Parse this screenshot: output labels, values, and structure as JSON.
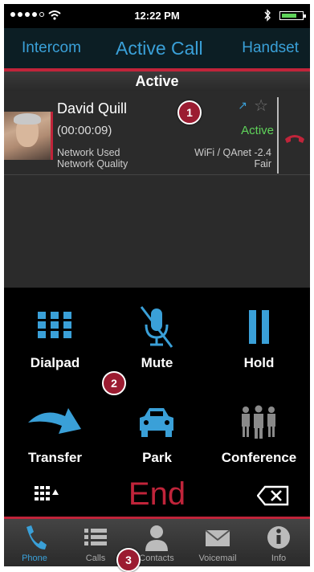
{
  "status_bar": {
    "time": "12:22 PM"
  },
  "nav": {
    "left": "Intercom",
    "center": "Active Call",
    "right": "Handset"
  },
  "section_title": "Active",
  "call": {
    "name": "David Quill",
    "duration": "(00:00:09)",
    "state": "Active",
    "network_used_label": "Network Used",
    "network_quality_label": "Network Quality",
    "network_value": "WiFi / QAnet -2.4",
    "quality_value": "Fair"
  },
  "controls": {
    "dialpad": "Dialpad",
    "mute": "Mute",
    "hold": "Hold",
    "transfer": "Transfer",
    "park": "Park",
    "conference": "Conference",
    "end": "End"
  },
  "tabs": [
    {
      "label": "Phone",
      "icon": "phone-icon"
    },
    {
      "label": "Calls",
      "icon": "list-icon"
    },
    {
      "label": "Contacts",
      "icon": "contact-icon"
    },
    {
      "label": "Voicemail",
      "icon": "envelope-icon"
    },
    {
      "label": "Info",
      "icon": "info-icon"
    }
  ],
  "badges": [
    "1",
    "2",
    "3"
  ],
  "colors": {
    "accent": "#3aa0d8",
    "end": "#c0243a",
    "active": "#5fd35a",
    "badge": "#9b1c31"
  }
}
